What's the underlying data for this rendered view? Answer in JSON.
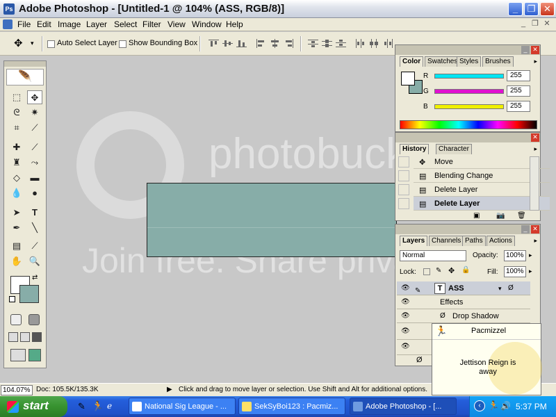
{
  "window": {
    "title": "Adobe Photoshop - [Untitled-1 @ 104% (ASS, RGB/8)]",
    "minimize": "_",
    "restore": "❐",
    "close": "✕"
  },
  "menu": {
    "items": [
      "File",
      "Edit",
      "Image",
      "Layer",
      "Select",
      "Filter",
      "View",
      "Window",
      "Help"
    ]
  },
  "options": {
    "auto_select": "Auto Select Layer",
    "bounding_box": "Show Bounding Box",
    "tool_arrow": "▾"
  },
  "watermark": {
    "brand": "photobucket",
    "tagline": "Join free. Share privately."
  },
  "color_panel": {
    "tabs": [
      "Color",
      "Swatches",
      "Styles",
      "Brushes"
    ],
    "fg": "#ffffff",
    "bg": "#87ada8",
    "channels": [
      {
        "label": "R",
        "value": "255",
        "color": "#00e5f2"
      },
      {
        "label": "G",
        "value": "255",
        "color": "#e010d0"
      },
      {
        "label": "B",
        "value": "255",
        "color": "#f0f000"
      }
    ]
  },
  "history_panel": {
    "tabs": [
      "History",
      "Character"
    ],
    "items": [
      "Move",
      "Blending Change",
      "Delete Layer",
      "Delete Layer"
    ]
  },
  "layers_panel": {
    "tabs": [
      "Layers",
      "Channels",
      "Paths",
      "Actions"
    ],
    "blend_mode": "Normal",
    "opacity_label": "Opacity:",
    "opacity": "100%",
    "lock_label": "Lock:",
    "fill_label": "Fill:",
    "fill": "100%",
    "layer_name": "ASS",
    "effects": "Effects",
    "drop_shadow": "Drop Shadow"
  },
  "status": {
    "zoom": "104.07%",
    "doc": "Doc: 105.5K/135.3K",
    "hint": "Click and drag to move layer or selection.  Use Shift and Alt for additional options."
  },
  "aim": {
    "buddy": "Pacmizzel",
    "message": "Jettison Reign is away"
  },
  "taskbar": {
    "start": "start",
    "tasks": [
      "National Sig League - ...",
      "SekSyBoi123 : Pacmiz...",
      "Adobe Photoshop - [..."
    ],
    "clock": "5:37 PM"
  }
}
